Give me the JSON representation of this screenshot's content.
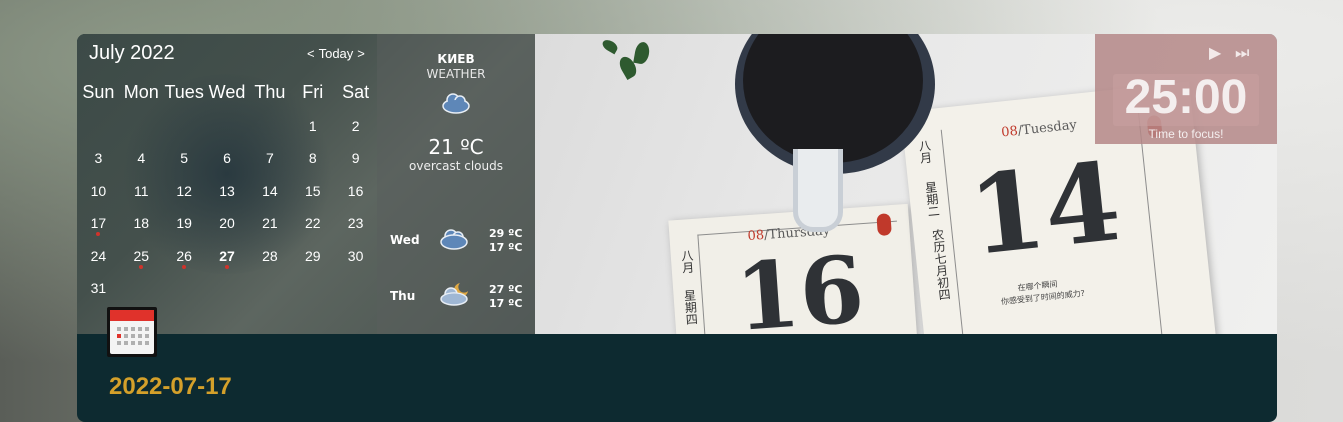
{
  "calendar": {
    "month_title": "July 2022",
    "nav": {
      "prev": "<",
      "today": "Today",
      "next": ">"
    },
    "weekdays": [
      "Sun",
      "Mon",
      "Tues",
      "Wed",
      "Thu",
      "Fri",
      "Sat"
    ],
    "weeks": [
      [
        "",
        "",
        "",
        "",
        "",
        "1",
        "2"
      ],
      [
        "3",
        "4",
        "5",
        "6",
        "7",
        "8",
        "9"
      ],
      [
        "10",
        "11",
        "12",
        "13",
        "14",
        "15",
        "16"
      ],
      [
        "17",
        "18",
        "19",
        "20",
        "21",
        "22",
        "23"
      ],
      [
        "24",
        "25",
        "26",
        "27",
        "28",
        "29",
        "30"
      ],
      [
        "31",
        "",
        "",
        "",
        "",
        "",
        ""
      ]
    ],
    "marked_days": [
      "17",
      "25",
      "26",
      "27"
    ],
    "today": "27",
    "selected_date": "2022-07-17",
    "icon": "calendar-icon"
  },
  "weather": {
    "city": "КИЕВ",
    "label": "WEATHER",
    "current_temp": "21 ºC",
    "description": "overcast clouds",
    "current_icon": "cloud-icon",
    "forecast": [
      {
        "day": "Wed",
        "high": "29 ºC",
        "low": "17 ºC",
        "icon": "cloud-icon"
      },
      {
        "day": "Thu",
        "high": "27 ºC",
        "low": "17 ºC",
        "icon": "cloud-moon-icon"
      }
    ]
  },
  "timer": {
    "time": "25:00",
    "label": "Time to focus!",
    "play_icon": "▶",
    "skip_icon": "⏭"
  },
  "photo": {
    "paper1": {
      "date_red": "08",
      "date_rest": "/Tuesday",
      "day": "14",
      "vertical_1": "八月",
      "vertical_2": "星期二",
      "vertical_3": "农历七月初四",
      "caption_1": "在哪个瞬间",
      "caption_2": "你感受到了时间的威力?"
    },
    "paper2": {
      "date_red": "08",
      "date_rest": "/Thursday",
      "day": "16",
      "vertical_1": "八月",
      "vertical_2": "星期四"
    }
  },
  "colors": {
    "date_text": "#d4a02a",
    "card_bottom": "#0d2a30",
    "timer_bg": "#b48787",
    "event_dot": "#d0332b"
  }
}
